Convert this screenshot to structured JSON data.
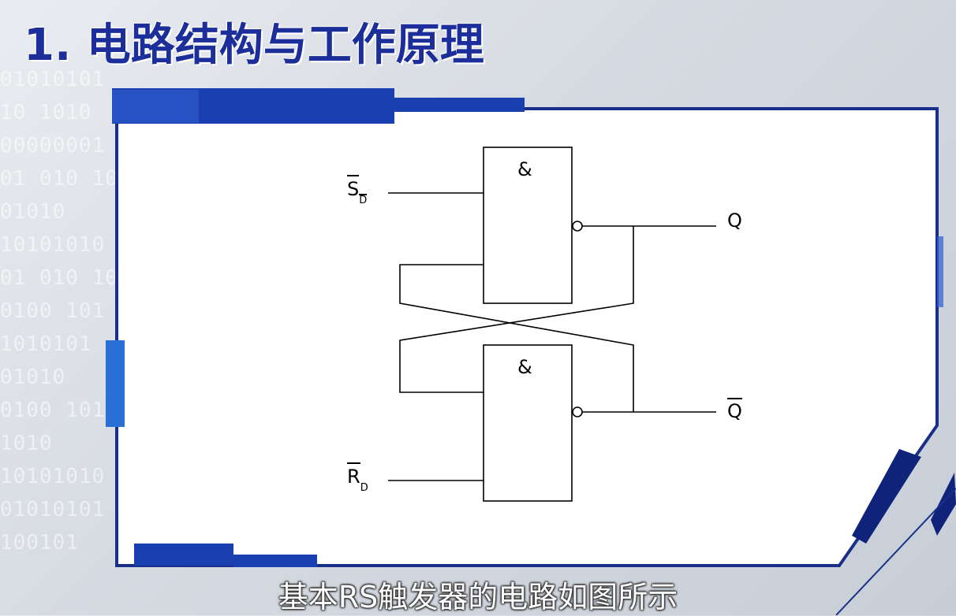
{
  "page": {
    "title": "1. 电路结构与工作原理"
  },
  "circuit": {
    "gate_symbol": "&",
    "input_top": {
      "letter": "S",
      "subscript": "D"
    },
    "input_bottom": {
      "letter": "R",
      "subscript": "D"
    },
    "output_top": "Q",
    "output_bottom": "Q"
  },
  "caption": "基本RS触发器的电路如图所示",
  "colors": {
    "title": "#1c2e9a",
    "accent": "#1a3fb0",
    "dark_blue": "#0f237a"
  }
}
